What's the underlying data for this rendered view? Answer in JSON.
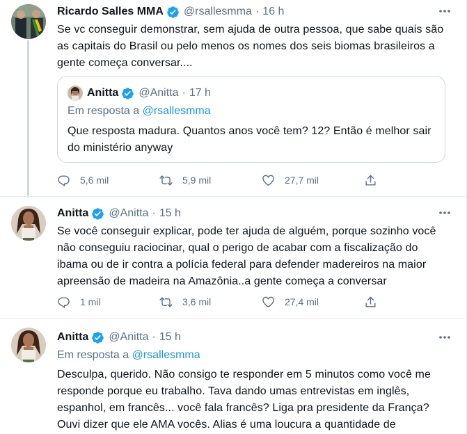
{
  "tweets": [
    {
      "name": "Ricardo Salles MMA",
      "handle": "@rsallesmma",
      "time": "16 h",
      "text_lines": [
        "Se vc conseguir demonstrar, sem ajuda de outra pessoa, que sabe quais são",
        "as capitais do Brasil ou pelo menos os nomes dos seis biomas brasileiros a",
        "gente começa conversar...."
      ],
      "quote": {
        "name": "Anitta",
        "handle": "@Anitta",
        "time": "17 h",
        "replying_prefix": "Em resposta a",
        "replying_to": "@rsallesmma",
        "text_lines": [
          "Que resposta madura. Quantos anos você tem? 12? Então é melhor sair",
          "do ministério anyway"
        ]
      },
      "replies": "5,6 mil",
      "retweets": "5,9 mil",
      "likes": "27,7 mil"
    },
    {
      "name": "Anitta",
      "handle": "@Anitta",
      "time": "15 h",
      "text_lines": [
        "Se você conseguir explicar, pode ter ajuda de alguém, porque sozinho você",
        "não conseguiu raciocinar, qual o perigo de acabar com a fiscalização do",
        "ibama ou de ir contra a polícia federal para defender madereiros na maior",
        "apreensão de madeira na Amazônia..a gente começa a conversar"
      ],
      "replies": "1 mil",
      "retweets": "3,6 mil",
      "likes": "27,4 mil"
    },
    {
      "name": "Anitta",
      "handle": "@Anitta",
      "time": "15 h",
      "replying_prefix": "Em resposta a",
      "replying_to": "@rsallesmma",
      "text_lines": [
        "Desculpa, querido. Não consigo te responder em 5 minutos como você me",
        "responde porque eu trabalho. Tava dando umas entrevistas em inglês,",
        "espanhol, em francês... você fala francês? Liga pra presidente da França?",
        "Ouvi dizer que ele AMA vocês. Alias é uma loucura a quantidade de"
      ]
    }
  ],
  "colors": {
    "text": "#0f1419",
    "secondary": "#5b7083",
    "link": "#1b95e0",
    "verified": "#1da1f2",
    "divider": "#e6ecf0"
  },
  "separator_dot": "·"
}
